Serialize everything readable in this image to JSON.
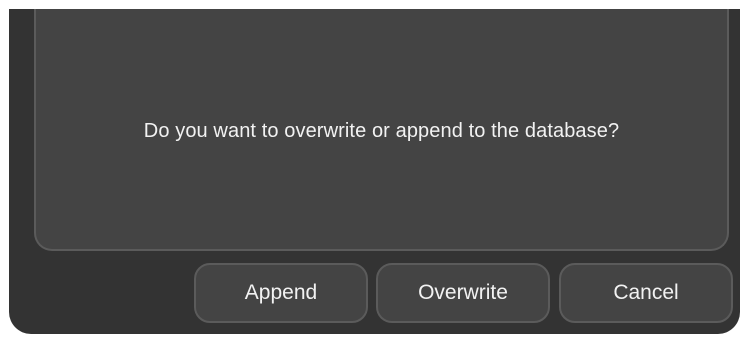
{
  "dialog": {
    "message": "Do you want to overwrite or append to the database?",
    "buttons": {
      "append_label": "Append",
      "overwrite_label": "Overwrite",
      "cancel_label": "Cancel"
    }
  },
  "colors": {
    "dialog_background": "#333333",
    "panel_background": "#444444",
    "border": "#5b5b5b",
    "text": "#f2f2f2"
  }
}
